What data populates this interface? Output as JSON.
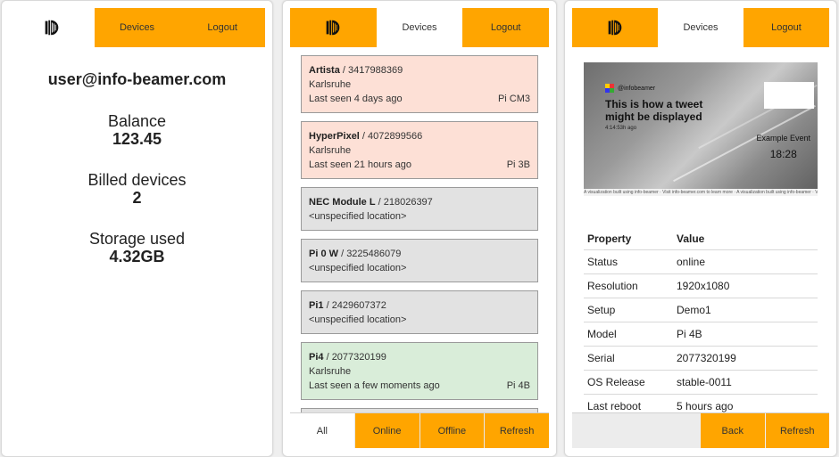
{
  "colors": {
    "accent": "#ffa500",
    "seen_card": "#fde0d6",
    "unknown_card": "#e2e2e2",
    "online_card": "#d9edd9"
  },
  "nav": {
    "logo_icon": "info-beamer-logo-icon",
    "devices_label": "Devices",
    "logout_label": "Logout"
  },
  "account": {
    "email": "user@info-beamer.com",
    "balance_label": "Balance",
    "balance_value": "123.45",
    "billed_label": "Billed devices",
    "billed_value": "2",
    "storage_label": "Storage used",
    "storage_value": "4.32GB"
  },
  "devices": [
    {
      "name": "Artista",
      "sep": " / ",
      "serial": "3417988369",
      "location": "Karlsruhe",
      "last_seen": "Last seen 4 days ago",
      "model": "Pi CM3",
      "state": "seen"
    },
    {
      "name": "HyperPixel",
      "sep": " / ",
      "serial": "4072899566",
      "location": "Karlsruhe",
      "last_seen": "Last seen 21 hours ago",
      "model": "Pi 3B",
      "state": "seen"
    },
    {
      "name": "NEC Module L",
      "sep": " / ",
      "serial": "218026397",
      "location": "<unspecified location>",
      "state": "unknown"
    },
    {
      "name": "Pi 0 W",
      "sep": " / ",
      "serial": "3225486079",
      "location": "<unspecified location>",
      "state": "unknown"
    },
    {
      "name": "Pi1",
      "sep": " / ",
      "serial": "2429607372",
      "location": "<unspecified location>",
      "state": "unknown"
    },
    {
      "name": "Pi4",
      "sep": " / ",
      "serial": "2077320199",
      "location": "Karlsruhe",
      "last_seen": "Last seen a few moments ago",
      "model": "Pi 4B",
      "state": "online"
    }
  ],
  "filters": {
    "all": "All",
    "online": "Online",
    "offline": "Offline",
    "refresh": "Refresh"
  },
  "detail": {
    "preview": {
      "handle": "@infobeamer",
      "tweet": "This is how a tweet might be displayed",
      "time": "4:14:53h ago",
      "event_name": "Example Event",
      "event_time": "18:28",
      "ticker": "A visualization built using info-beamer   ·   Visit info-beamer.com to learn more   ·   A visualization built using info-beamer   ·   Visit info-beamer.com to learn more"
    },
    "header_property": "Property",
    "header_value": "Value",
    "rows": [
      {
        "key": "Status",
        "value": "online"
      },
      {
        "key": "Resolution",
        "value": "1920x1080"
      },
      {
        "key": "Setup",
        "value": "Demo1"
      },
      {
        "key": "Model",
        "value": "Pi 4B"
      },
      {
        "key": "Serial",
        "value": "2077320199"
      },
      {
        "key": "OS Release",
        "value": "stable-0011"
      },
      {
        "key": "Last reboot",
        "value": "5 hours ago"
      }
    ],
    "back_label": "Back",
    "refresh_label": "Refresh"
  }
}
